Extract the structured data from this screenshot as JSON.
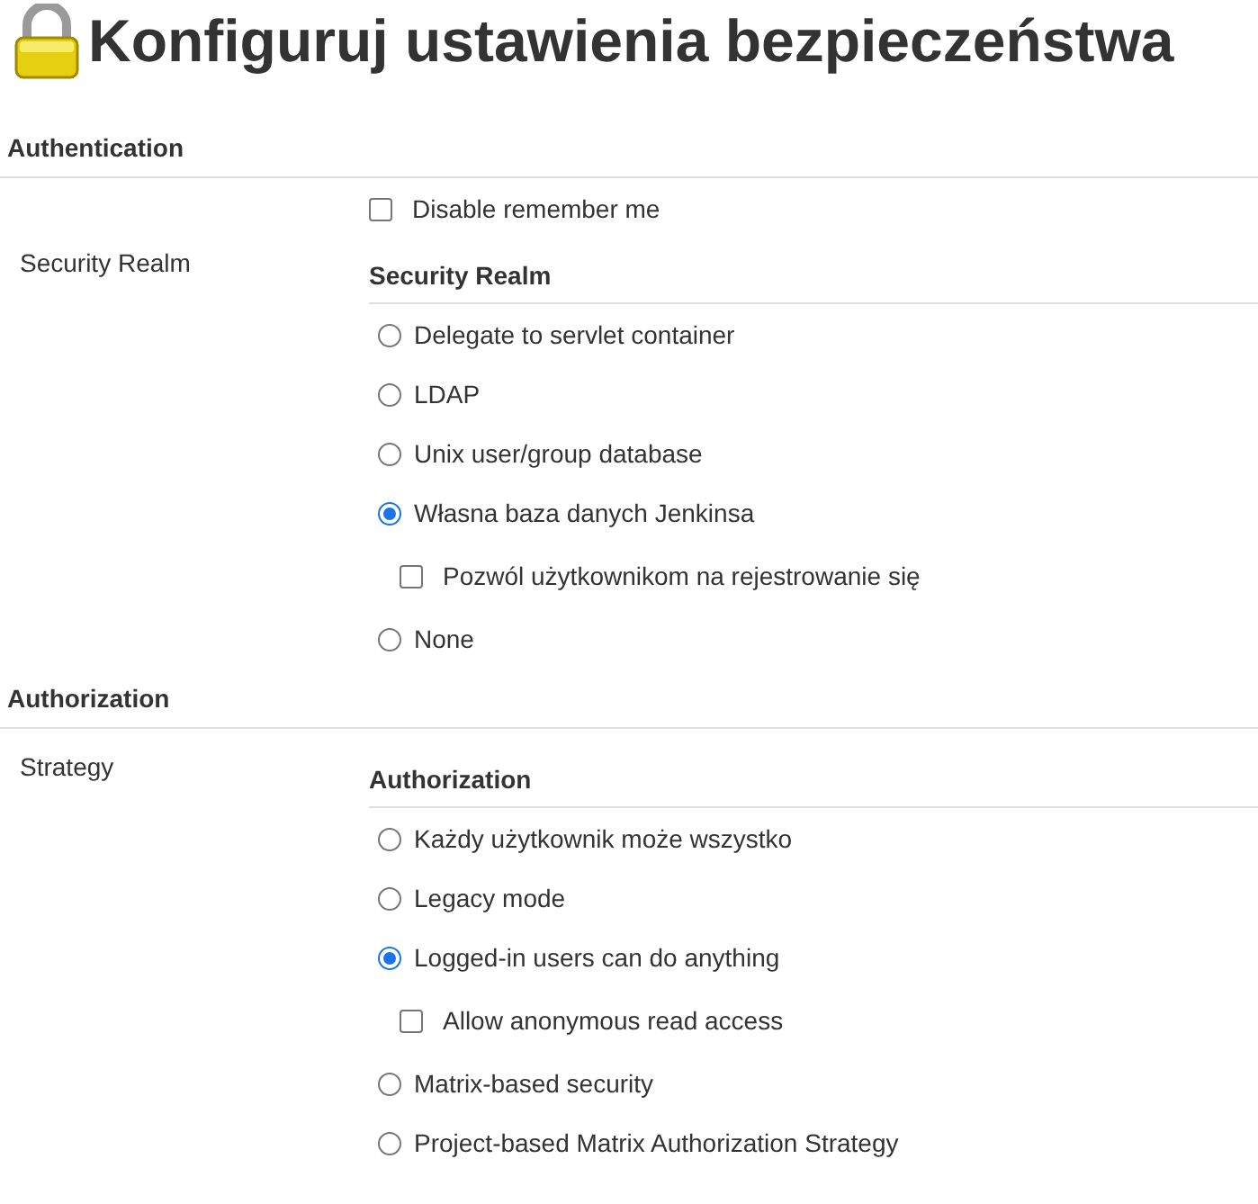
{
  "title": "Konfiguruj ustawienia bezpieczeństwa",
  "sections": [
    {
      "heading": "Authentication",
      "checkboxes": [
        {
          "label": "Disable remember me",
          "checked": false
        }
      ],
      "field_label": "Security Realm",
      "group_heading": "Security Realm",
      "options": [
        {
          "label": "Delegate to servlet container",
          "selected": false
        },
        {
          "label": "LDAP",
          "selected": false
        },
        {
          "label": "Unix user/group database",
          "selected": false
        },
        {
          "label": "Własna baza danych Jenkinsa",
          "selected": true,
          "sub_options": [
            {
              "label": "Pozwól użytkownikom na rejestrowanie się",
              "checked": false
            }
          ]
        },
        {
          "label": "None",
          "selected": false
        }
      ]
    },
    {
      "heading": "Authorization",
      "field_label": "Strategy",
      "group_heading": "Authorization",
      "options": [
        {
          "label": "Każdy użytkownik może wszystko",
          "selected": false
        },
        {
          "label": "Legacy mode",
          "selected": false
        },
        {
          "label": "Logged-in users can do anything",
          "selected": true,
          "sub_options": [
            {
              "label": "Allow anonymous read access",
              "checked": false
            }
          ]
        },
        {
          "label": "Matrix-based security",
          "selected": false
        },
        {
          "label": "Project-based Matrix Authorization Strategy",
          "selected": false
        }
      ]
    }
  ]
}
